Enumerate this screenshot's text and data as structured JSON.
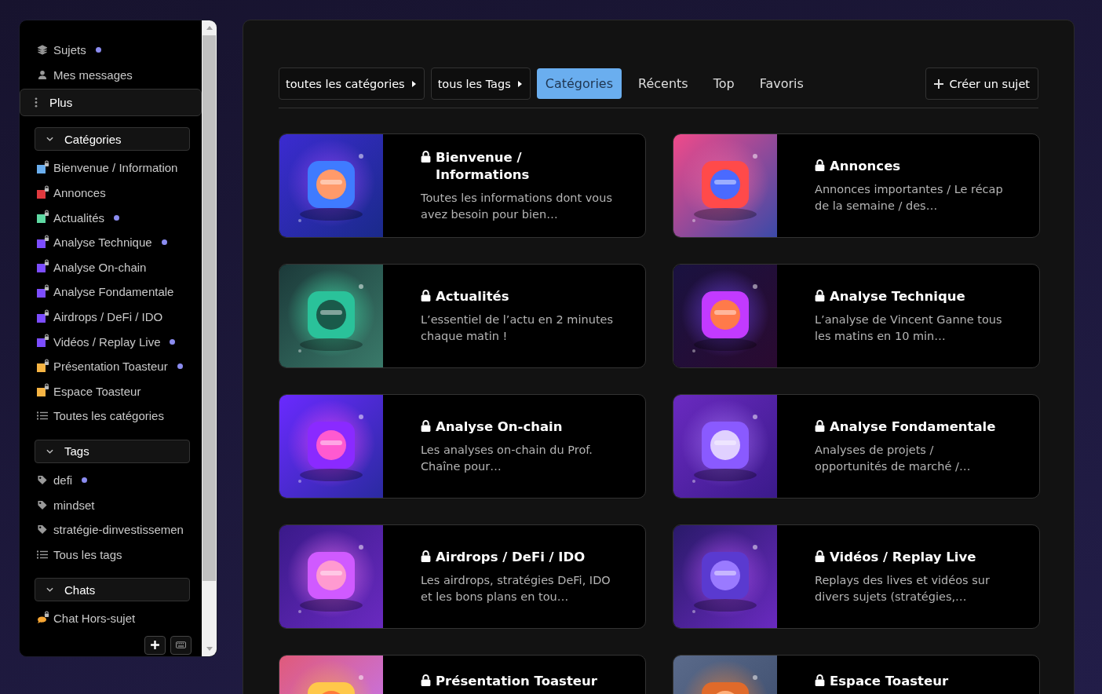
{
  "sidebar": {
    "nav": [
      {
        "kind": "topics",
        "label": "Sujets",
        "unread": true
      },
      {
        "kind": "messages",
        "label": "Mes messages",
        "unread": false
      }
    ],
    "more": {
      "label": "Plus"
    },
    "sections": [
      {
        "title": "Catégories",
        "expanded": true,
        "items": [
          {
            "kind": "category",
            "label": "Bienvenue / Information",
            "color": "#6aaeee",
            "unread": false
          },
          {
            "kind": "category",
            "label": "Annonces",
            "color": "#e0393e",
            "unread": false
          },
          {
            "kind": "category",
            "label": "Actualités",
            "color": "#5fd9a3",
            "unread": true
          },
          {
            "kind": "category",
            "label": "Analyse Technique",
            "color": "#7c4dff",
            "unread": true
          },
          {
            "kind": "category",
            "label": "Analyse On-chain",
            "color": "#7c4dff",
            "unread": false
          },
          {
            "kind": "category",
            "label": "Analyse Fondamentale",
            "color": "#7c4dff",
            "unread": false
          },
          {
            "kind": "category",
            "label": "Airdrops / DeFi / IDO",
            "color": "#7c4dff",
            "unread": false
          },
          {
            "kind": "category",
            "label": "Vidéos / Replay Live",
            "color": "#7c4dff",
            "unread": true
          },
          {
            "kind": "category",
            "label": "Présentation Toasteur",
            "color": "#f6b443",
            "unread": true
          },
          {
            "kind": "category",
            "label": "Espace Toasteur",
            "color": "#f6b443",
            "unread": false
          },
          {
            "kind": "all",
            "label": "Toutes les catégories",
            "unread": false
          }
        ]
      },
      {
        "title": "Tags",
        "expanded": true,
        "items": [
          {
            "kind": "tag",
            "label": "defi",
            "unread": true
          },
          {
            "kind": "tag",
            "label": "mindset",
            "unread": false
          },
          {
            "kind": "tag",
            "label": "stratégie-dinvestissemen",
            "unread": false
          },
          {
            "kind": "all",
            "label": "Tous les tags",
            "unread": false
          }
        ]
      },
      {
        "title": "Chats",
        "expanded": true,
        "items": [
          {
            "kind": "chat",
            "label": "Chat Hors-sujet",
            "unread": false
          }
        ]
      }
    ]
  },
  "filters": {
    "dropdowns": [
      "toutes les catégories",
      "tous les Tags"
    ],
    "tabs": [
      {
        "label": "Catégories",
        "selected": true
      },
      {
        "label": "Récents",
        "selected": false
      },
      {
        "label": "Top",
        "selected": false
      },
      {
        "label": "Favoris",
        "selected": false
      }
    ],
    "create_button": "Créer un sujet"
  },
  "cards": [
    {
      "title": "Bienvenue / Informations",
      "description": "Toutes les informations dont vous avez besoin pour bien…",
      "locked": true
    },
    {
      "title": "Annonces",
      "description": "Annonces importantes / Le récap de la semaine / des…",
      "locked": true
    },
    {
      "title": "Actualités",
      "description": "L’essentiel de l’actu en 2 minutes chaque matin !",
      "locked": true
    },
    {
      "title": "Analyse Technique",
      "description": "L’analyse de Vincent Ganne tous les matins en 10 min…",
      "locked": true
    },
    {
      "title": "Analyse On-chain",
      "description": "Les analyses on-chain du Prof. Chaîne pour…",
      "locked": true
    },
    {
      "title": "Analyse Fondamentale",
      "description": "Analyses de projets / opportunités de marché /…",
      "locked": true
    },
    {
      "title": "Airdrops / DeFi / IDO",
      "description": "Les airdrops, stratégies DeFi, IDO et les bons plans en tou…",
      "locked": true
    },
    {
      "title": "Vidéos / Replay Live",
      "description": "Replays des lives et vidéos sur divers sujets (stratégies,…",
      "locked": true
    },
    {
      "title": "Présentation Toasteur",
      "locked": true
    },
    {
      "title": "Espace Toasteur",
      "locked": true
    }
  ]
}
